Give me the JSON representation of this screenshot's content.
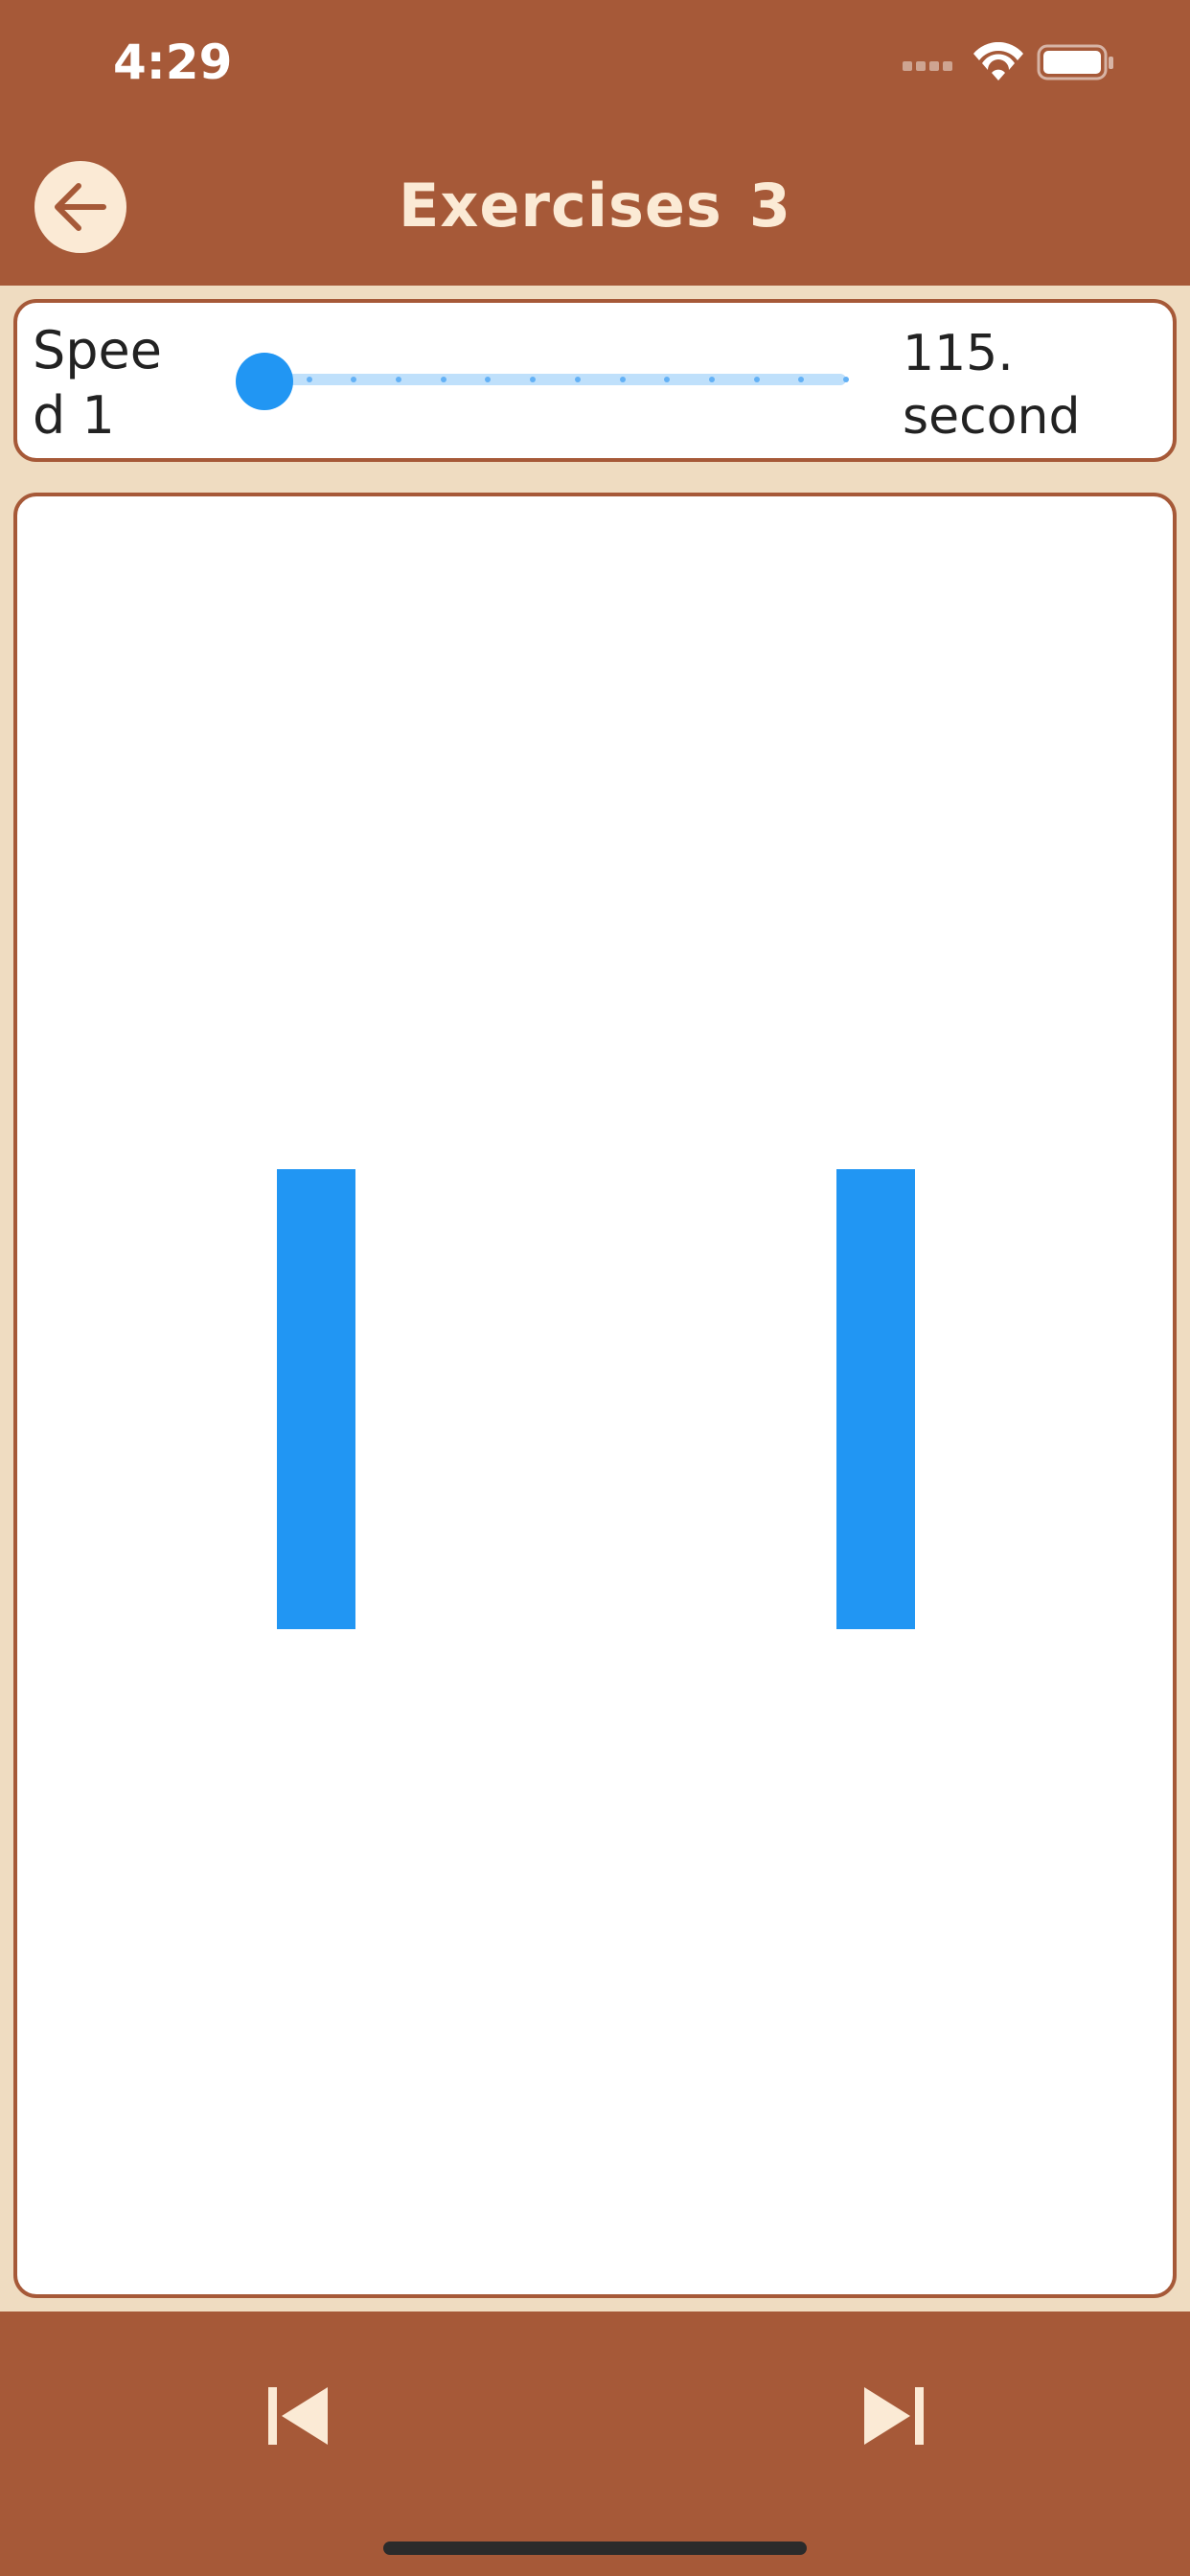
{
  "status_bar": {
    "time": "4:29"
  },
  "header": {
    "title": "Exercises",
    "exercise_number": "3"
  },
  "speed": {
    "label": "Speed 1",
    "duration": "115. second",
    "slider_value": 1,
    "slider_min": 1,
    "slider_max": 14
  },
  "colors": {
    "brand": "#a65938",
    "background": "#efdcc1",
    "accent": "#2196f3",
    "light_cream": "#fbead5"
  },
  "icons": {
    "back": "arrow-left-icon",
    "previous": "skip-previous-icon",
    "next": "skip-next-icon"
  }
}
